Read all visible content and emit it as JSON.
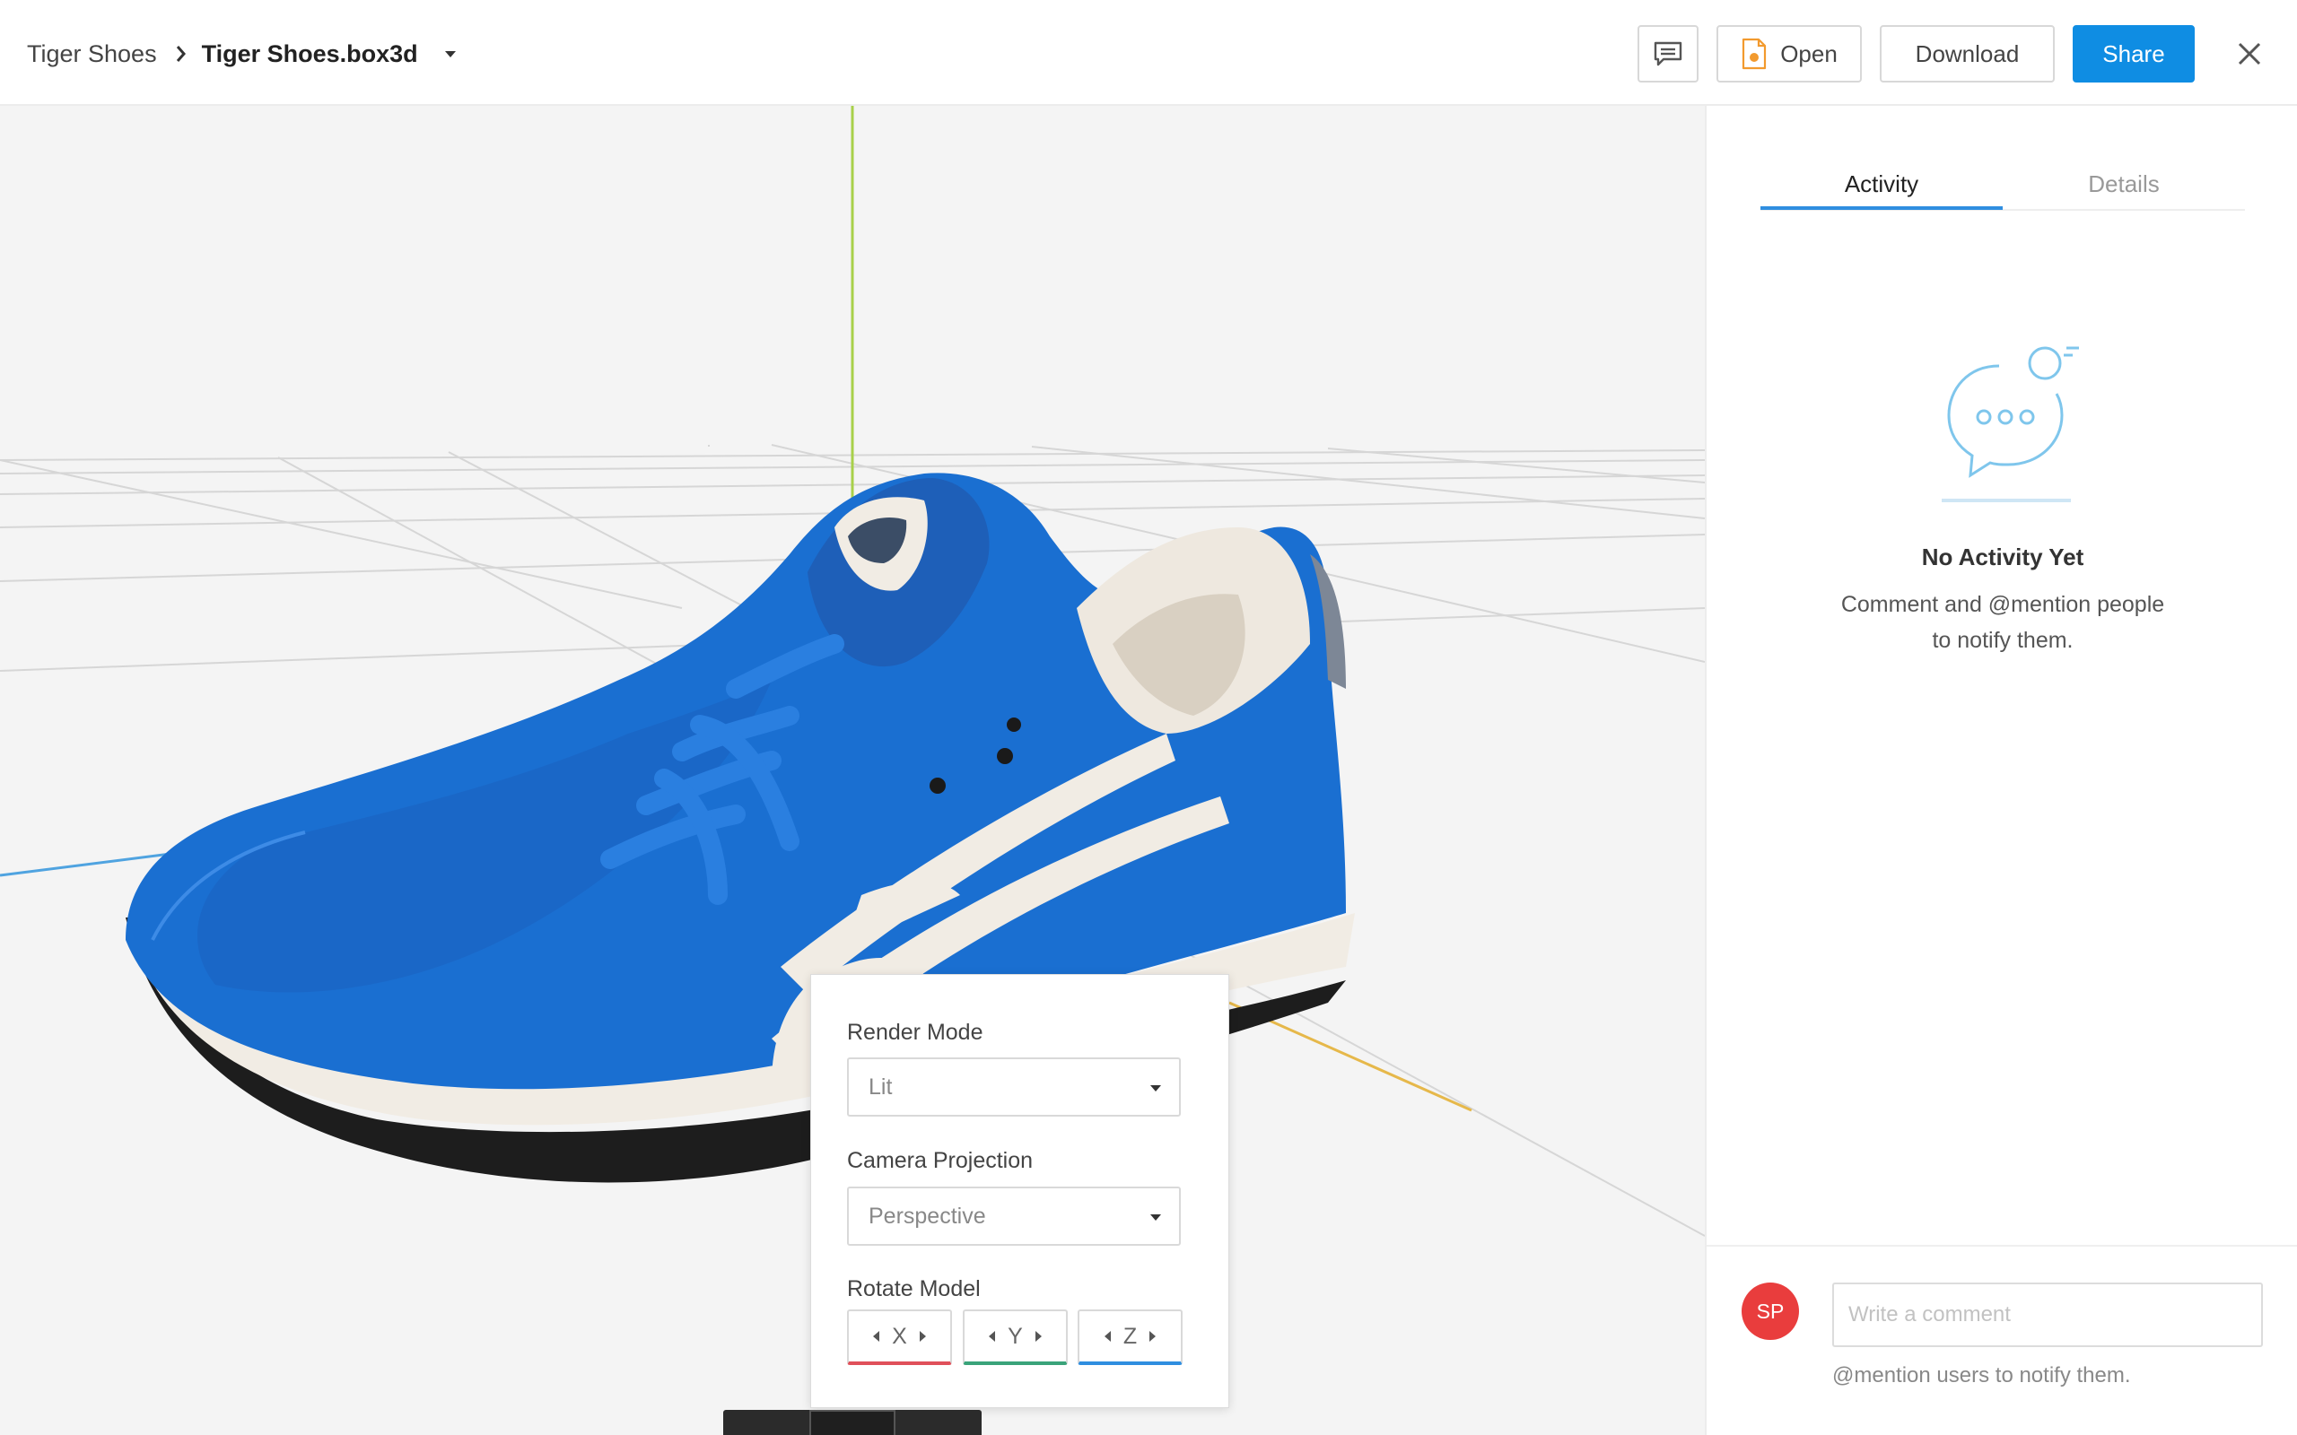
{
  "header": {
    "breadcrumb_parent": "Tiger Shoes",
    "breadcrumb_file": "Tiger Shoes.box3d",
    "open_label": "Open",
    "download_label": "Download",
    "share_label": "Share"
  },
  "settings": {
    "render_mode_label": "Render Mode",
    "render_mode_value": "Lit",
    "camera_projection_label": "Camera Projection",
    "camera_projection_value": "Perspective",
    "rotate_model_label": "Rotate Model",
    "axes": [
      "X",
      "Y",
      "Z"
    ],
    "axis_colors": [
      "#e0505a",
      "#3aa37a",
      "#2f8ee0"
    ]
  },
  "toolbar": {
    "icons": [
      "history-icon",
      "gear-icon",
      "fullscreen-icon"
    ]
  },
  "sidebar": {
    "tabs": [
      {
        "label": "Activity",
        "active": true
      },
      {
        "label": "Details",
        "active": false
      }
    ],
    "empty_title": "No Activity Yet",
    "empty_line1": "Comment and @mention people",
    "empty_line2": "to notify them.",
    "avatar_initials": "SP",
    "comment_placeholder": "Write a comment",
    "mention_hint": "@mention users to notify them."
  },
  "colors": {
    "accent": "#0f8de3",
    "avatar": "#e93d3d",
    "shoe_blue": "#1a6fd1"
  }
}
